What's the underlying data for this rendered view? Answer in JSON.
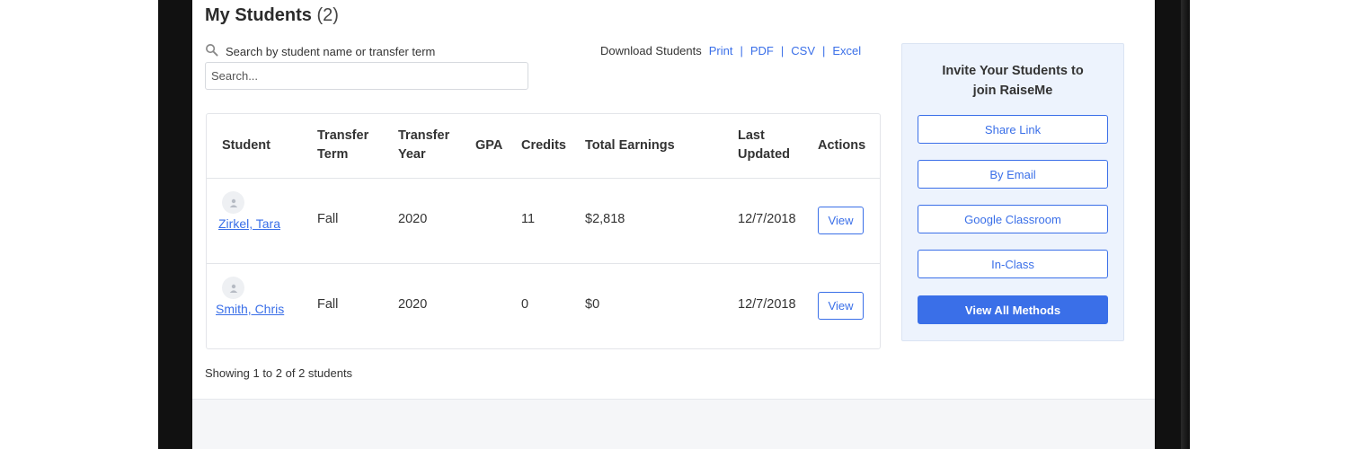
{
  "page": {
    "title": "My Students",
    "count": "(2)"
  },
  "search": {
    "label": "Search by student name or transfer term",
    "placeholder": "Search...",
    "value": ""
  },
  "downloads": {
    "label": "Download Students",
    "print": "Print",
    "pdf": "PDF",
    "csv": "CSV",
    "excel": "Excel",
    "separator": "|"
  },
  "table": {
    "headers": {
      "student": "Student",
      "transfer_term_1": "Transfer",
      "transfer_term_2": "Term",
      "transfer_year_1": "Transfer",
      "transfer_year_2": "Year",
      "gpa": "GPA",
      "credits": "Credits",
      "total_earnings": "Total Earnings",
      "last_updated_1": "Last",
      "last_updated_2": "Updated",
      "actions": "Actions"
    },
    "rows": [
      {
        "student": "Zirkel, Tara",
        "transfer_term": "Fall",
        "transfer_year": "2020",
        "gpa": "",
        "credits": "11",
        "total_earnings": "$2,818",
        "last_updated": "12/7/2018",
        "action": "View"
      },
      {
        "student": "Smith, Chris",
        "transfer_term": "Fall",
        "transfer_year": "2020",
        "gpa": "",
        "credits": "0",
        "total_earnings": "$0",
        "last_updated": "12/7/2018",
        "action": "View"
      }
    ]
  },
  "showing": "Showing 1 to 2 of 2 students",
  "invite": {
    "title_line1": "Invite Your Students to",
    "title_line2": "join RaiseMe",
    "share_link": "Share Link",
    "by_email": "By Email",
    "google_classroom": "Google Classroom",
    "in_class": "In-Class",
    "view_all": "View All Methods"
  },
  "icons": {
    "search": "search-icon",
    "avatar": "user-avatar-icon"
  },
  "colors": {
    "link": "#3a6fe8",
    "primary_button": "#3a6fe8",
    "invite_panel_bg": "#edf3fd",
    "device_frame": "#111111"
  }
}
